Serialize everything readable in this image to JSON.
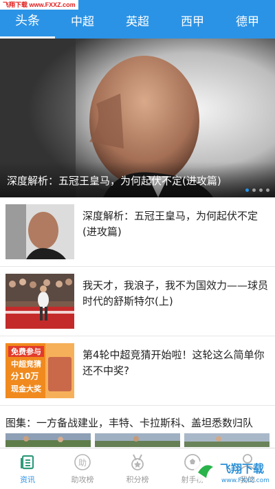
{
  "watermark": {
    "top_text": "飞翔下载 www.FXXZ.com",
    "bottom_logo": "飞翔下载",
    "bottom_url": "www.FXXZ.com"
  },
  "tabs": [
    {
      "label": "头条",
      "active": true
    },
    {
      "label": "中超",
      "active": false
    },
    {
      "label": "英超",
      "active": false
    },
    {
      "label": "西甲",
      "active": false
    },
    {
      "label": "德甲",
      "active": false
    }
  ],
  "banner": {
    "caption": "深度解析：五冠王皇马，为何起伏不定(进攻篇)",
    "slide_count": 4,
    "active_slide": 1
  },
  "news": [
    {
      "title": "深度解析：五冠王皇马，为何起伏不定(进攻篇)"
    },
    {
      "title": "我天才，我浪子，我不为国效力——球员时代的舒斯特尔(上)"
    },
    {
      "title": "第4轮中超竞猜开始啦！这轮这么简单你还不中奖?"
    }
  ],
  "promo_thumb": {
    "lines": [
      "免费参与",
      "中超竞猜",
      "分10万",
      "现金大奖"
    ]
  },
  "gallery": {
    "title": "图集：一方备战建业，丰特、卡拉斯科、盖坦悉数归队"
  },
  "bottom_nav": [
    {
      "label": "资讯",
      "icon": "news-icon",
      "active": true
    },
    {
      "label": "助攻榜",
      "icon": "assist-icon",
      "active": false
    },
    {
      "label": "积分榜",
      "icon": "medal-icon",
      "active": false
    },
    {
      "label": "射手榜",
      "icon": "ball-icon",
      "active": false
    },
    {
      "label": "我的",
      "icon": "user-icon",
      "active": false
    }
  ],
  "colors": {
    "primary": "#2b93e6",
    "text": "#222222",
    "muted": "#9a9a9a"
  }
}
